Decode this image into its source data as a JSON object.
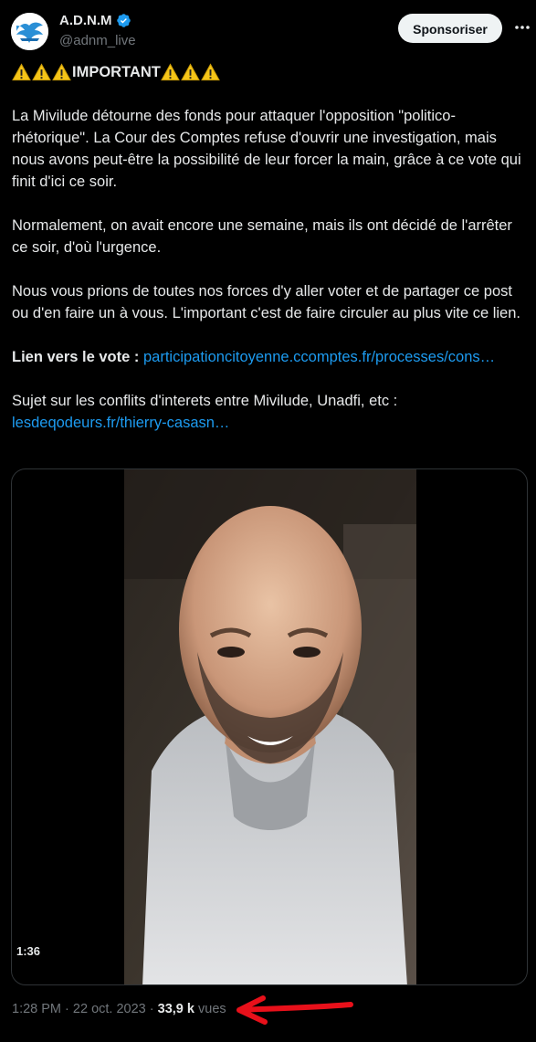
{
  "author": {
    "display_name": "A.D.N.M",
    "handle": "@adnm_live",
    "verified_icon": "verified-badge-icon",
    "avatar_icon": "eagle-logo-avatar"
  },
  "header": {
    "sponsor_label": "Sponsoriser",
    "more_icon": "more-horizontal-icon"
  },
  "tweet": {
    "headline": "IMPORTANT",
    "warning_icon": "warning-sign-emoji",
    "paragraph1": "La Mivilude détourne des fonds pour attaquer l'opposition \"politico-rhétorique\". La Cour des Comptes refuse d'ouvrir une investigation, mais nous avons peut-être la possibilité de leur forcer la main, grâce à ce vote qui finit d'ici ce soir.",
    "paragraph2": "Normalement, on avait encore une semaine, mais ils ont décidé de l'arrêter ce soir, d'où l'urgence.",
    "paragraph3": "Nous vous prions de toutes nos forces d'y aller voter et de partager ce post ou d'en faire un à vous. L'important c'est de faire circuler au plus vite ce lien.",
    "vote_label": "Lien vers le vote :",
    "vote_link": "participationcitoyenne.ccomptes.fr/processes/cons…",
    "subject_label": "Sujet sur les conflits d'interets entre Mivilude, Unadfi, etc :",
    "subject_link": "lesdeqodeurs.fr/thierry-casasn…"
  },
  "media": {
    "type": "video",
    "duration": "1:36"
  },
  "footer": {
    "time": "1:28 PM",
    "separator": "·",
    "date": "22 oct. 2023",
    "views_count": "33,9 k",
    "views_label": "vues"
  },
  "annotation": {
    "arrow_color": "#e8101a"
  },
  "colors": {
    "background": "#000000",
    "text": "#e7e9ea",
    "secondary": "#71767b",
    "link": "#1d9bf0",
    "verified": "#1d9bf0"
  }
}
